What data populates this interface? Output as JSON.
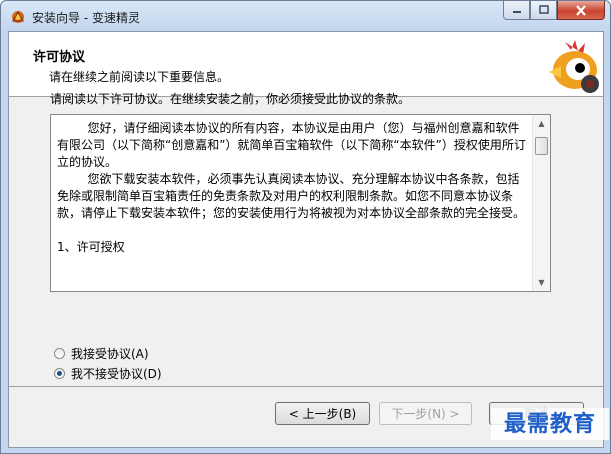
{
  "window": {
    "title": "安装向导 - 变速精灵",
    "icon": "gear-app-icon",
    "buttons": [
      "minimize-icon",
      "maximize-icon",
      "close-icon"
    ]
  },
  "header": {
    "title": "许可协议",
    "subtitle": "请在继续之前阅读以下重要信息。"
  },
  "main": {
    "intro": "请阅读以下许可协议。在继续安装之前，你必须接受此协议的条款。",
    "license_text": "        您好，请仔细阅读本协议的所有内容，本协议是由用户（您）与福州创意嘉和软件有限公司（以下简称“创意嘉和”）就简单百宝箱软件（以下简称“本软件”）授权使用所订立的协议。\n        您欲下载安装本软件，必须事先认真阅读本协议、充分理解本协议中各条款，包括免除或限制简单百宝箱责任的免责条款及对用户的权利限制条款。如您不同意本协议条款，请停止下载安装本软件；您的安装使用行为将被视为对本协议全部条款的完全接受。\n\n1、许可授权",
    "accept_label": "我接受协议(A)",
    "decline_label": "我不接受协议(D)",
    "selected": "decline"
  },
  "footer": {
    "back_label": "< 上一步(B)",
    "next_label": "下一步(N) >",
    "cancel_label": "取消"
  },
  "watermark": "最需教育",
  "colors": {
    "accent": "#1f5fc8",
    "close": "#c8452f"
  }
}
